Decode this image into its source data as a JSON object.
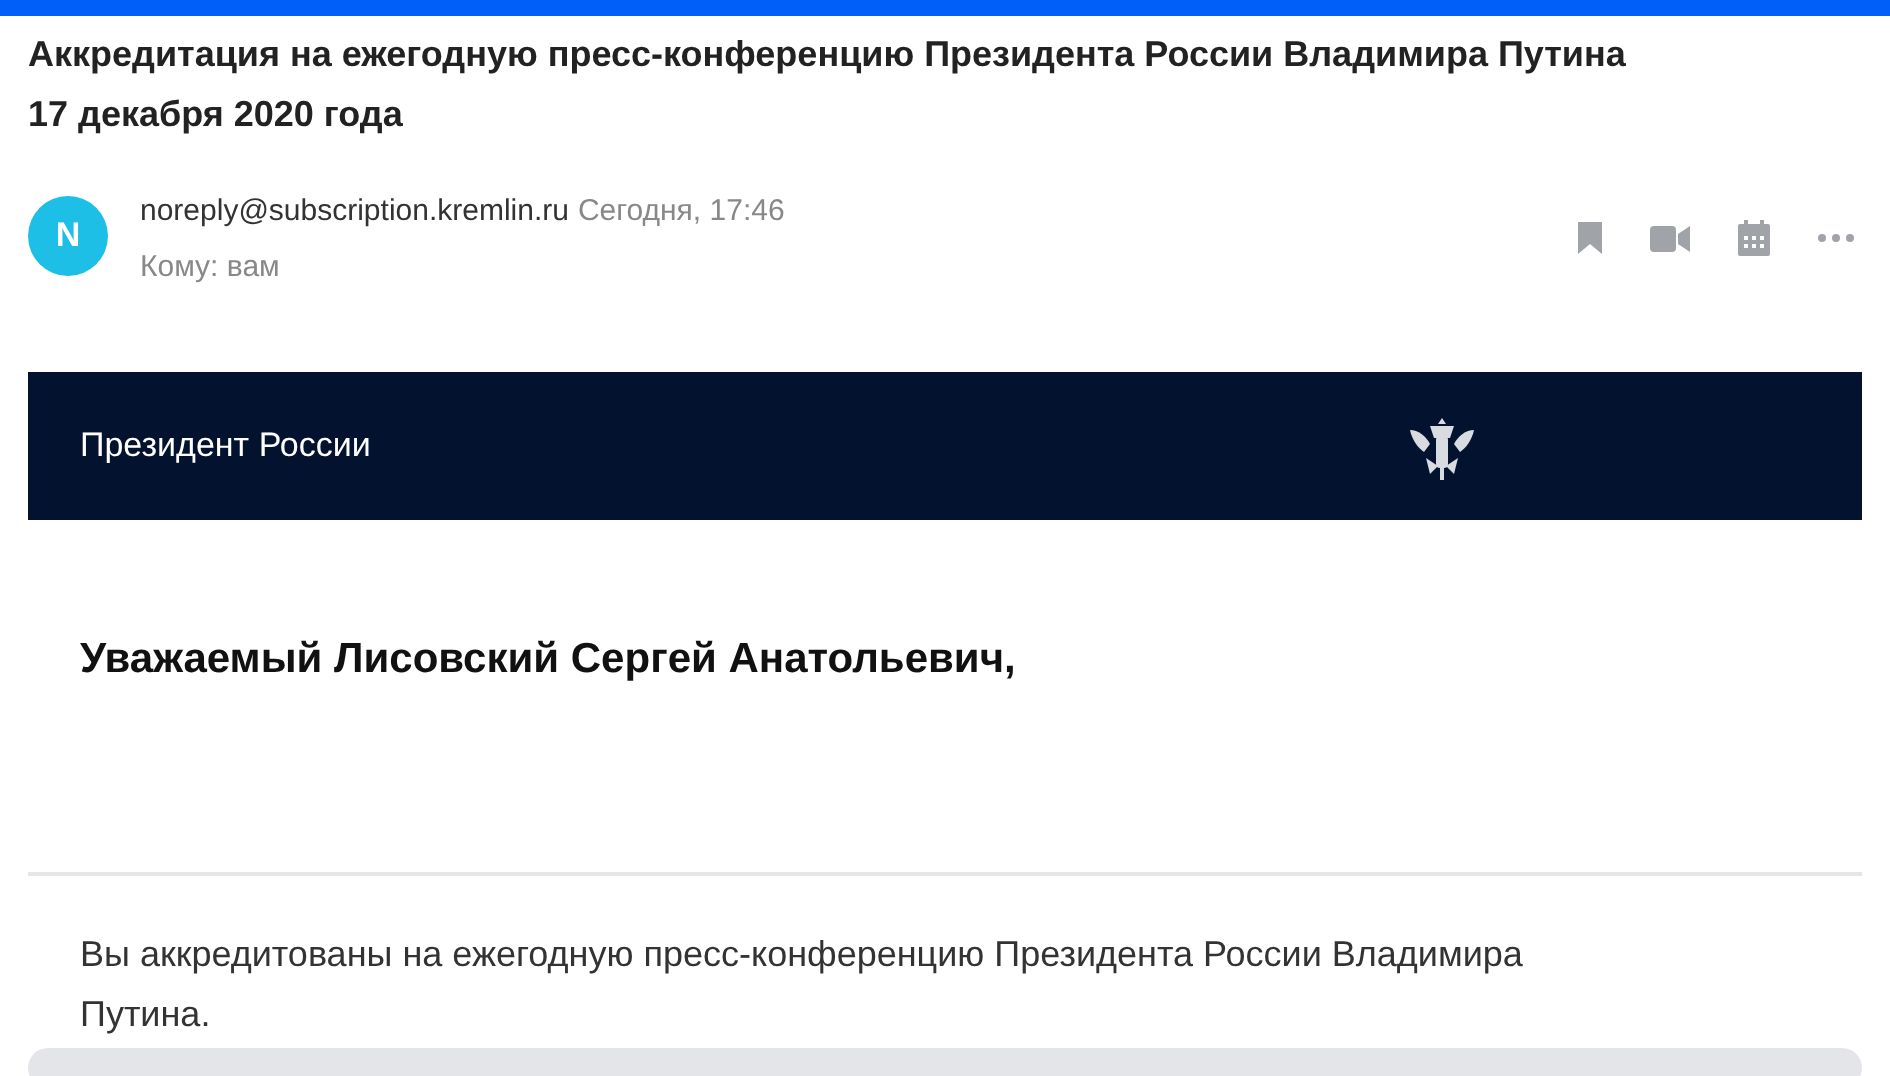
{
  "subject": "Аккредитация на ежегодную пресс-конференцию Президента России Владимира Путина 17 декабря 2020 года",
  "sender": {
    "avatar_letter": "N",
    "address": "noreply@subscription.kremlin.ru",
    "time": "Сегодня, 17:46",
    "recipient": "Кому: вам"
  },
  "banner": {
    "title": "Президент России"
  },
  "greeting": "Уважаемый Лисовский Сергей Анатольевич,",
  "body": "Вы аккредитованы на ежегодную пресс-конференцию Президента России Владимира Путина."
}
